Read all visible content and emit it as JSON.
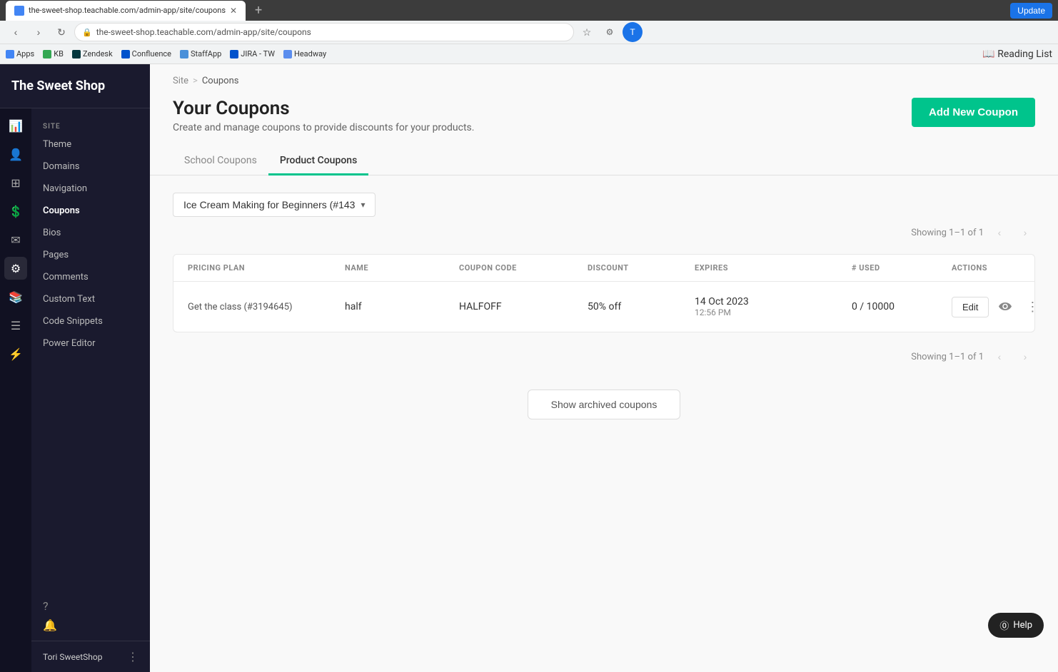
{
  "browser": {
    "url": "the-sweet-shop.teachable.com/admin-app/site/coupons",
    "tab_title": "the-sweet-shop.teachable.com/admin-app/site/coupons",
    "bookmarks": [
      {
        "label": "Apps",
        "color": "#4285f4"
      },
      {
        "label": "KB",
        "color": "#34a853"
      },
      {
        "label": "Zendesk",
        "color": "#03363d"
      },
      {
        "label": "Confluence",
        "color": "#0052cc"
      },
      {
        "label": "StaffApp",
        "color": "#4a90d9"
      },
      {
        "label": "JIRA - TW",
        "color": "#0052cc"
      },
      {
        "label": "Headway",
        "color": "#5b8dee"
      }
    ],
    "update_btn": "Update",
    "reading_list": "Reading List"
  },
  "sidebar": {
    "logo": "The Sweet Shop",
    "section_label": "SITE",
    "nav_items": [
      {
        "label": "Theme",
        "active": false
      },
      {
        "label": "Domains",
        "active": false
      },
      {
        "label": "Navigation",
        "active": false
      },
      {
        "label": "Coupons",
        "active": true
      },
      {
        "label": "Bios",
        "active": false
      },
      {
        "label": "Pages",
        "active": false
      },
      {
        "label": "Comments",
        "active": false
      },
      {
        "label": "Custom Text",
        "active": false
      },
      {
        "label": "Code Snippets",
        "active": false
      },
      {
        "label": "Power Editor",
        "active": false
      }
    ],
    "footer_name": "Tori SweetShop",
    "footer_dots": "⋮",
    "bottom_icons": [
      "?",
      "🔔"
    ]
  },
  "breadcrumb": {
    "site": "Site",
    "separator": ">",
    "current": "Coupons"
  },
  "page": {
    "title": "Your Coupons",
    "subtitle": "Create and manage coupons to provide discounts for your products.",
    "add_btn": "Add New Coupon"
  },
  "tabs": [
    {
      "label": "School Coupons",
      "active": false
    },
    {
      "label": "Product Coupons",
      "active": true
    }
  ],
  "dropdown": {
    "label": "Ice Cream Making for Beginners (#143"
  },
  "pagination_top": {
    "showing": "Showing 1–1 of 1"
  },
  "pagination_bottom": {
    "showing": "Showing 1–1 of 1"
  },
  "table": {
    "headers": [
      "PRICING PLAN",
      "NAME",
      "COUPON CODE",
      "DISCOUNT",
      "EXPIRES",
      "# USED",
      "ACTIONS"
    ],
    "rows": [
      {
        "pricing_plan": "Get the class (#3194645)",
        "name": "half",
        "coupon_code": "HALFOFF",
        "discount": "50% off",
        "expires_line1": "14 Oct 2023",
        "expires_line2": "12:56 PM",
        "used": "0 / 10000",
        "edit_label": "Edit"
      }
    ]
  },
  "show_archived_btn": "Show archived coupons",
  "help_btn": "Help"
}
